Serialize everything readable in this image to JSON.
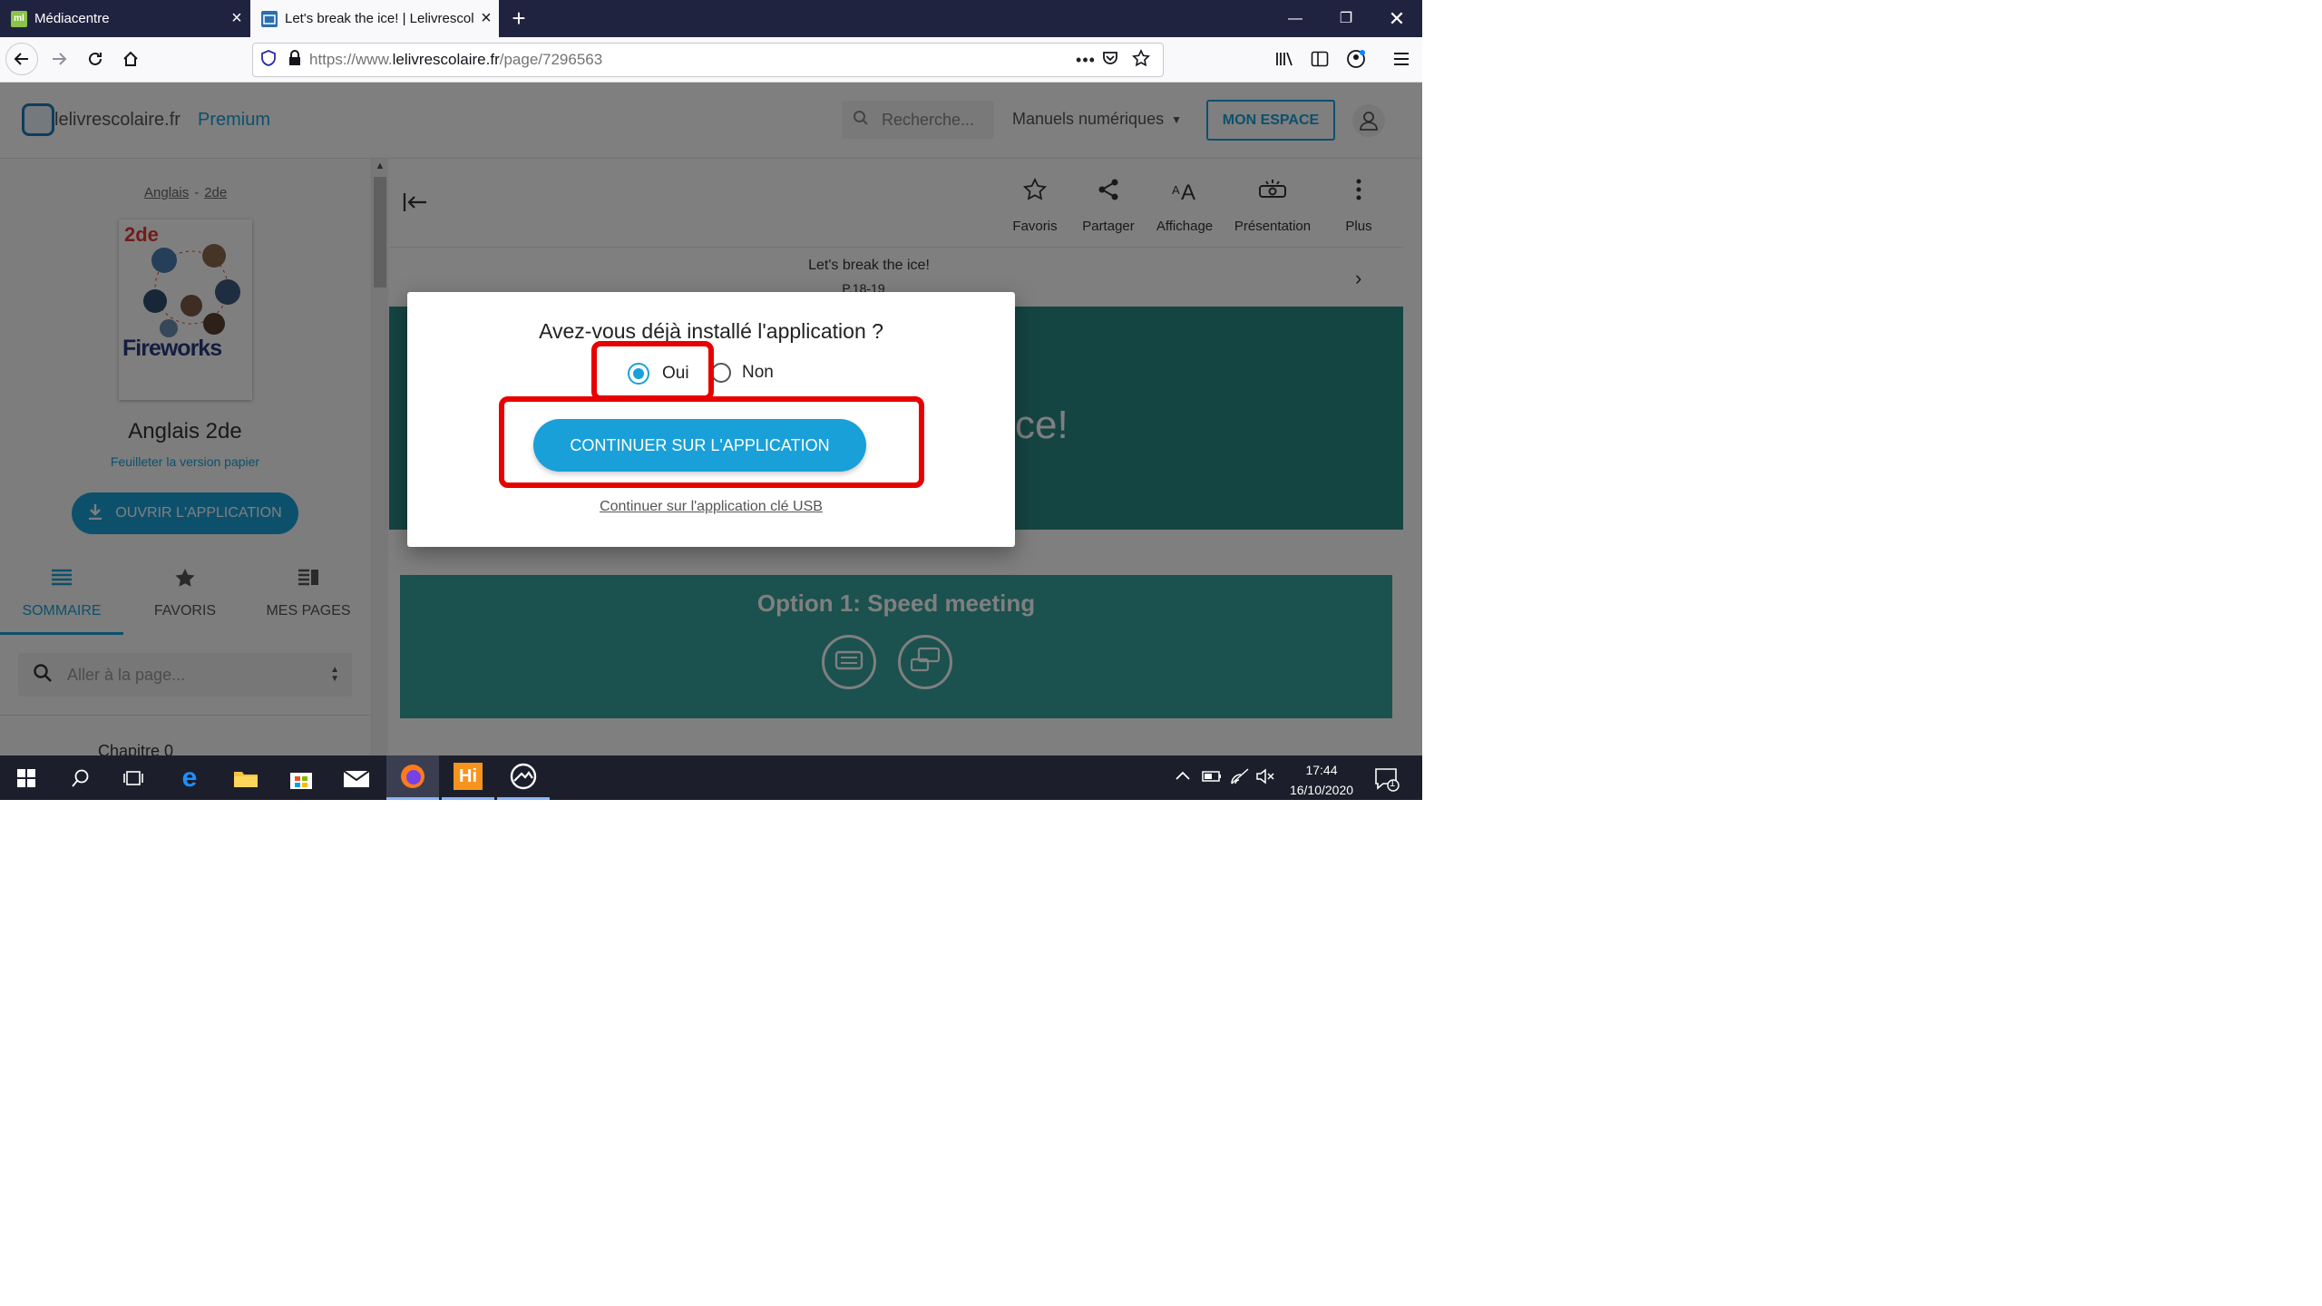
{
  "browser": {
    "tabs": [
      {
        "title": "Médiacentre",
        "favicon_text": "ml",
        "active": false
      },
      {
        "title": "Let's break the ice! | Lelivrescol",
        "favicon_text": "",
        "active": true
      }
    ],
    "url_prefix": "https://www.",
    "url_domain": "lelivrescolaire.fr",
    "url_path": "/page/7296563"
  },
  "site": {
    "logo_text": "lelivrescolaire.fr",
    "premium_label": "Premium",
    "search_placeholder": "Recherche...",
    "manuels_label": "Manuels numériques",
    "mon_espace_label": "MON ESPACE"
  },
  "sidebar": {
    "breadcrumb_subject": "Anglais",
    "breadcrumb_sep": "-",
    "breadcrumb_level": "2de",
    "cover_level": "2de",
    "cover_title": "Fireworks",
    "book_title": "Anglais 2de",
    "paper_link": "Feuilleter la version papier",
    "open_app_button": "OUVRIR L'APPLICATION",
    "tabs": [
      {
        "label": "SOMMAIRE",
        "icon": "list-icon",
        "active": true
      },
      {
        "label": "FAVORIS",
        "icon": "star-icon",
        "active": false
      },
      {
        "label": "MES PAGES",
        "icon": "pages-icon",
        "active": false
      }
    ],
    "goto_placeholder": "Aller à la page...",
    "chapter_label": "Chapitre 0"
  },
  "toolbar": {
    "items": [
      {
        "label": "Favoris",
        "icon": "star-outline-icon"
      },
      {
        "label": "Partager",
        "icon": "share-icon"
      },
      {
        "label": "Affichage",
        "icon": "font-size-icon"
      },
      {
        "label": "Présentation",
        "icon": "projector-icon"
      },
      {
        "label": "Plus",
        "icon": "more-vertical-icon"
      }
    ]
  },
  "lesson": {
    "title": "Let's break the ice!",
    "pages": "P.18-19",
    "banner_title_fragment": "ce!",
    "option_title": "Option 1: Speed meeting"
  },
  "modal": {
    "question": "Avez-vous déjà installé l'application ?",
    "option_yes": "Oui",
    "option_no": "Non",
    "selected": "Oui",
    "continue_button": "CONTINUER SUR L'APPLICATION",
    "usb_link": "Continuer sur l'application clé USB"
  },
  "taskbar": {
    "time": "17:44",
    "date": "16/10/2020",
    "notification_count": "1"
  },
  "colors": {
    "accent": "#00a0d6",
    "teal": "#2a8a86",
    "highlight": "#e80000"
  }
}
